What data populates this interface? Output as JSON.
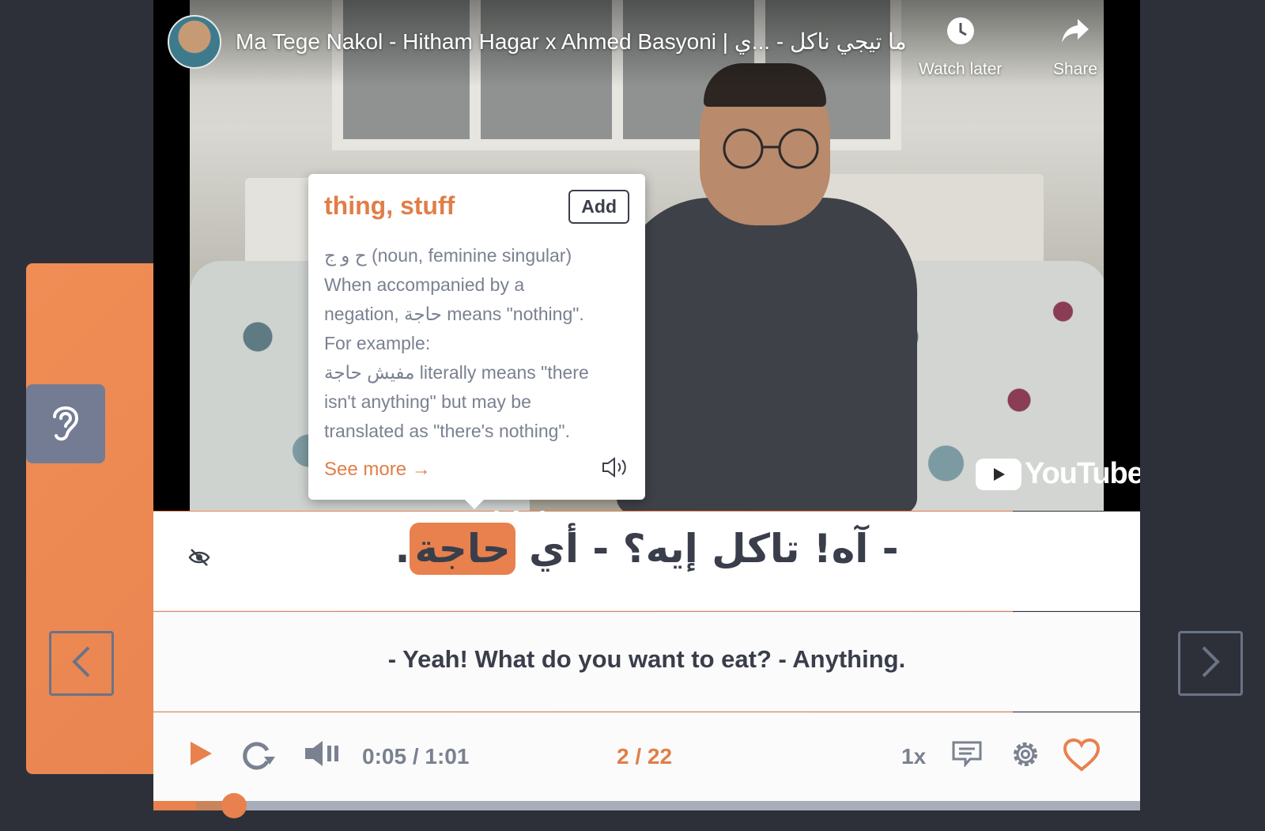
{
  "video": {
    "title": "Ma Tege Nakol - Hitham Hagar x Ahmed Basyoni | ما تيجي ناكل - ...ي",
    "watch_later_label": "Watch later",
    "share_label": "Share",
    "logo_text": "YouTube"
  },
  "popup": {
    "title": "thing, stuff",
    "add_label": "Add",
    "lines": [
      "ح و ج (noun, feminine singular)",
      "When accompanied by a",
      "negation, حاجة means \"nothing\".",
      "For example:",
      "مفيش حاجة literally means \"there",
      "isn't anything\" but may be",
      "translated as \"there's nothing\"."
    ],
    "see_more_label": "See more →"
  },
  "subtitle": {
    "arabic_prefix": "- آه! تاكل إيه؟ - أي ",
    "arabic_highlight": "حاجة",
    "arabic_suffix": ".",
    "english": "- Yeah! What do you want to eat? - Anything."
  },
  "controls": {
    "time": "0:05 / 1:01",
    "counter": "2 / 22",
    "speed": "1x",
    "progress_percent": 8.2,
    "buffer_percent": 4.3
  },
  "colors": {
    "accent": "#e8814d",
    "background": "#2d3039",
    "text_dark": "#3a3e4b",
    "text_muted": "#7a8190"
  }
}
